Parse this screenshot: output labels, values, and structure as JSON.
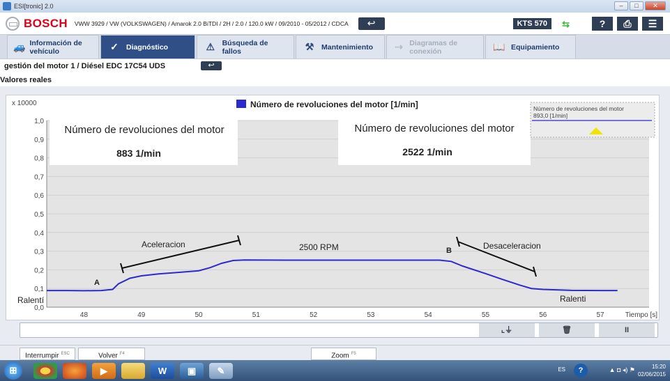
{
  "window": {
    "title": "ESI[tronic] 2.0"
  },
  "header": {
    "brand": "BOSCH",
    "vehicle": "VWW 3929 / VW (VOLKSWAGEN) / Amarok 2.0 BiTDI / 2H / 2.0 / 120.0 kW / 09/2010 - 05/2012 / CDCA",
    "device": "KTS 570",
    "help_label": "?"
  },
  "nav": {
    "tabs": [
      {
        "label": "Información de vehículo",
        "icon": "car-info-icon",
        "state": "normal"
      },
      {
        "label": "Diagnóstico",
        "icon": "diagnosis-icon",
        "state": "active"
      },
      {
        "label": "Búsqueda de fallos",
        "icon": "fault-search-icon",
        "state": "normal"
      },
      {
        "label": "Mantenimiento",
        "icon": "maintenance-icon",
        "state": "normal"
      },
      {
        "label": "Diagramas de conexión",
        "icon": "wiring-diagram-icon",
        "state": "disabled"
      },
      {
        "label": "Equipamiento",
        "icon": "equipment-book-icon",
        "state": "normal"
      }
    ]
  },
  "breadcrumb": {
    "path": "gestión del motor 1 / Diésel EDC 17C54 UDS",
    "section": "Valores reales"
  },
  "chart_data": {
    "type": "line",
    "title": "Número de revoluciones del motor [1/min]",
    "scale_label": "x 10000",
    "xlabel": "Tiempo [s]",
    "xlim": [
      47.35,
      57.85
    ],
    "ylim": [
      0,
      1.0
    ],
    "x_ticks": [
      "48",
      "49",
      "50",
      "51",
      "52",
      "53",
      "54",
      "55",
      "56",
      "57"
    ],
    "y_ticks": [
      "0,0",
      "0,1",
      "0,2",
      "0,3",
      "0,4",
      "0,5",
      "0,6",
      "0,7",
      "0,8",
      "0,9",
      "1,0"
    ],
    "grid": true,
    "series_color": "#2a2ad0",
    "series": [
      {
        "name": "Número de revoluciones del motor [1/min]",
        "points": [
          [
            47.35,
            0.089
          ],
          [
            47.7,
            0.089
          ],
          [
            48.0,
            0.088
          ],
          [
            48.3,
            0.089
          ],
          [
            48.5,
            0.095
          ],
          [
            48.6,
            0.125
          ],
          [
            48.8,
            0.155
          ],
          [
            49.0,
            0.168
          ],
          [
            49.3,
            0.178
          ],
          [
            49.6,
            0.185
          ],
          [
            50.0,
            0.195
          ],
          [
            50.2,
            0.212
          ],
          [
            50.4,
            0.235
          ],
          [
            50.6,
            0.25
          ],
          [
            50.8,
            0.253
          ],
          [
            51.5,
            0.252
          ],
          [
            52.5,
            0.252
          ],
          [
            53.5,
            0.252
          ],
          [
            54.2,
            0.252
          ],
          [
            54.4,
            0.245
          ],
          [
            54.6,
            0.22
          ],
          [
            55.0,
            0.18
          ],
          [
            55.3,
            0.148
          ],
          [
            55.6,
            0.118
          ],
          [
            55.8,
            0.1
          ],
          [
            56.0,
            0.095
          ],
          [
            56.5,
            0.09
          ],
          [
            57.0,
            0.089
          ],
          [
            57.3,
            0.089
          ]
        ]
      }
    ],
    "legend_box": {
      "name": "Número de revoluciones del motor",
      "value": "893,0 [1/min]"
    },
    "readouts": [
      {
        "label": "Número de revoluciones del motor",
        "value": "883 1/min"
      },
      {
        "label": "Número de revoluciones del motor",
        "value": "2522 1/min"
      }
    ],
    "annotations": [
      {
        "text": "Aceleracion"
      },
      {
        "text": "2500 RPM"
      },
      {
        "text": "Desaceleracion"
      },
      {
        "text": "A"
      },
      {
        "text": "B"
      },
      {
        "text": "Ralentí"
      },
      {
        "text": "Ralenti"
      }
    ]
  },
  "controls": {
    "pause_label": "II"
  },
  "footer": {
    "buttons": [
      {
        "label": "Interrumpir",
        "key": "ESC"
      },
      {
        "label": "Volver",
        "key": "F4"
      },
      {
        "label": "Zoom",
        "key": "F5"
      }
    ]
  },
  "taskbar": {
    "apps": [
      "start-orb-icon",
      "chrome-icon",
      "firefox-icon",
      "media-player-icon",
      "explorer-folder-icon",
      "word-icon",
      "esitronic-icon",
      "paint-icon"
    ],
    "language": "ES",
    "time": "15:20",
    "date": "02/06/2015"
  }
}
